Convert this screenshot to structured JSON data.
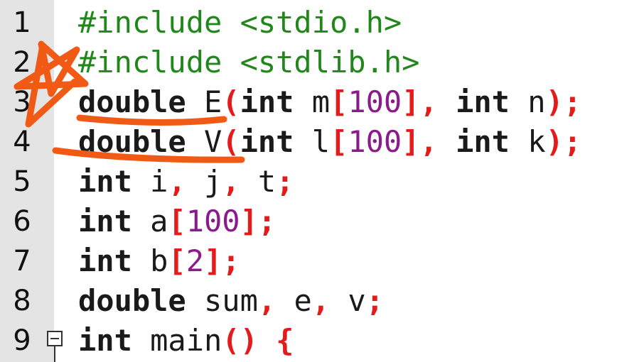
{
  "editor": {
    "lines": [
      {
        "number": "1",
        "tokens": [
          {
            "t": "#include <stdio.h>",
            "c": "pre"
          }
        ]
      },
      {
        "number": "2",
        "tokens": [
          {
            "t": "#include <stdlib.h>",
            "c": "pre"
          }
        ]
      },
      {
        "number": "3",
        "tokens": [
          {
            "t": "double",
            "c": "kw"
          },
          {
            "t": " E",
            "c": ""
          },
          {
            "t": "(",
            "c": "pun"
          },
          {
            "t": "int",
            "c": "kw"
          },
          {
            "t": " m",
            "c": ""
          },
          {
            "t": "[",
            "c": "pun"
          },
          {
            "t": "100",
            "c": "num"
          },
          {
            "t": "],",
            "c": "pun"
          },
          {
            "t": " ",
            "c": ""
          },
          {
            "t": "int",
            "c": "kw"
          },
          {
            "t": " n",
            "c": ""
          },
          {
            "t": ");",
            "c": "pun"
          }
        ]
      },
      {
        "number": "4",
        "tokens": [
          {
            "t": "double",
            "c": "kw"
          },
          {
            "t": " V",
            "c": ""
          },
          {
            "t": "(",
            "c": "pun"
          },
          {
            "t": "int",
            "c": "kw"
          },
          {
            "t": " l",
            "c": ""
          },
          {
            "t": "[",
            "c": "pun"
          },
          {
            "t": "100",
            "c": "num"
          },
          {
            "t": "],",
            "c": "pun"
          },
          {
            "t": " ",
            "c": ""
          },
          {
            "t": "int",
            "c": "kw"
          },
          {
            "t": " k",
            "c": ""
          },
          {
            "t": ");",
            "c": "pun"
          }
        ]
      },
      {
        "number": "5",
        "tokens": [
          {
            "t": "int",
            "c": "kw"
          },
          {
            "t": " i",
            "c": ""
          },
          {
            "t": ",",
            "c": "pun"
          },
          {
            "t": " j",
            "c": ""
          },
          {
            "t": ",",
            "c": "pun"
          },
          {
            "t": " t",
            "c": ""
          },
          {
            "t": ";",
            "c": "pun"
          }
        ]
      },
      {
        "number": "6",
        "tokens": [
          {
            "t": "int",
            "c": "kw"
          },
          {
            "t": " a",
            "c": ""
          },
          {
            "t": "[",
            "c": "pun"
          },
          {
            "t": "100",
            "c": "num"
          },
          {
            "t": "];",
            "c": "pun"
          }
        ]
      },
      {
        "number": "7",
        "tokens": [
          {
            "t": "int",
            "c": "kw"
          },
          {
            "t": " b",
            "c": ""
          },
          {
            "t": "[",
            "c": "pun"
          },
          {
            "t": "2",
            "c": "num"
          },
          {
            "t": "];",
            "c": "pun"
          }
        ]
      },
      {
        "number": "8",
        "tokens": [
          {
            "t": "double",
            "c": "kw"
          },
          {
            "t": " sum",
            "c": ""
          },
          {
            "t": ",",
            "c": "pun"
          },
          {
            "t": " e",
            "c": ""
          },
          {
            "t": ",",
            "c": "pun"
          },
          {
            "t": " v",
            "c": ""
          },
          {
            "t": ";",
            "c": "pun"
          }
        ]
      },
      {
        "number": "9",
        "tokens": [
          {
            "t": "int",
            "c": "kw"
          },
          {
            "t": " main",
            "c": ""
          },
          {
            "t": "()",
            "c": "pun"
          },
          {
            "t": " ",
            "c": ""
          },
          {
            "t": "{",
            "c": "pun"
          }
        ]
      }
    ]
  },
  "colors": {
    "preprocessor": "#21871b",
    "punctuation": "#e31b1b",
    "number": "#8b1a8b",
    "annotation": "#f05a14",
    "gutter": "#e4e4e4"
  },
  "icons": {
    "fold": "fold-collapse-icon",
    "annotation": "hand-drawn-star-annotation"
  }
}
